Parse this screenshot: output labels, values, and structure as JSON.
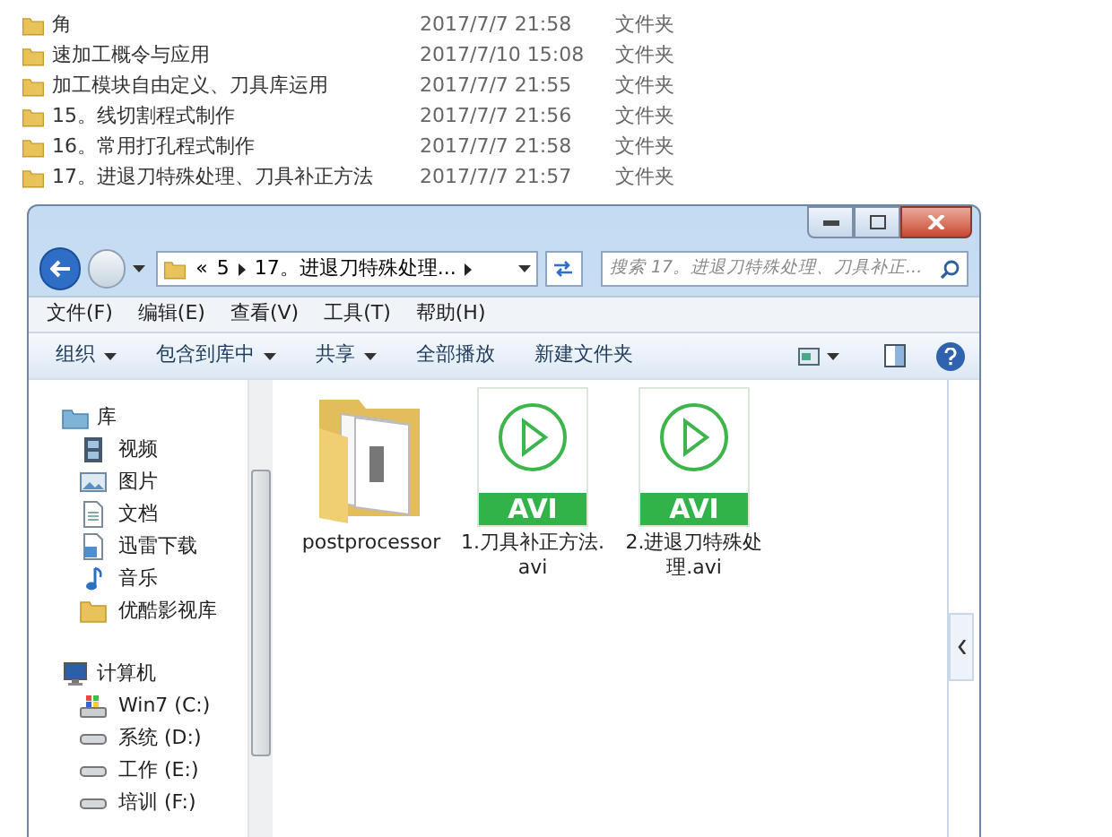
{
  "background_list": {
    "rows": [
      {
        "name": "角",
        "date": "2017/7/7 21:58",
        "type": "文件夹"
      },
      {
        "name": "速加工概令与应用",
        "date": "2017/7/10 15:08",
        "type": "文件夹"
      },
      {
        "name": "加工模块自由定义、刀具库运用",
        "date": "2017/7/7 21:55",
        "type": "文件夹"
      },
      {
        "name": "15。线切割程式制作",
        "date": "2017/7/7 21:56",
        "type": "文件夹"
      },
      {
        "name": "16。常用打孔程式制作",
        "date": "2017/7/7 21:58",
        "type": "文件夹"
      },
      {
        "name": "17。进退刀特殊处理、刀具补正方法",
        "date": "2017/7/7 21:57",
        "type": "文件夹"
      }
    ]
  },
  "window": {
    "address": {
      "overflow": "«",
      "crumbs": [
        "5",
        "17。进退刀特殊处理..."
      ]
    },
    "search": {
      "placeholder": "搜索 17。进退刀特殊处理、刀具补正..."
    },
    "menu": [
      "文件(F)",
      "编辑(E)",
      "查看(V)",
      "工具(T)",
      "帮助(H)"
    ],
    "toolbar": [
      {
        "label": "组织",
        "dropdown": true
      },
      {
        "label": "包含到库中",
        "dropdown": true
      },
      {
        "label": "共享",
        "dropdown": true
      },
      {
        "label": "全部播放",
        "dropdown": false
      },
      {
        "label": "新建文件夹",
        "dropdown": false
      }
    ],
    "sidebar": [
      {
        "label": "库",
        "children": [
          {
            "label": "视频"
          },
          {
            "label": "图片"
          },
          {
            "label": "文档"
          },
          {
            "label": "迅雷下载"
          },
          {
            "label": "音乐"
          },
          {
            "label": "优酷影视库"
          }
        ]
      },
      {
        "label": "计算机",
        "children": [
          {
            "label": "Win7 (C:)"
          },
          {
            "label": "系统 (D:)"
          },
          {
            "label": "工作 (E:)"
          },
          {
            "label": "培训 (F:)"
          }
        ]
      }
    ],
    "files": [
      {
        "name": "postprocessor",
        "kind": "folder"
      },
      {
        "name": "1.刀具补正方法.avi",
        "kind": "avi",
        "badge": "AVI"
      },
      {
        "name": "2.进退刀特殊处理.avi",
        "kind": "avi",
        "badge": "AVI"
      }
    ]
  }
}
